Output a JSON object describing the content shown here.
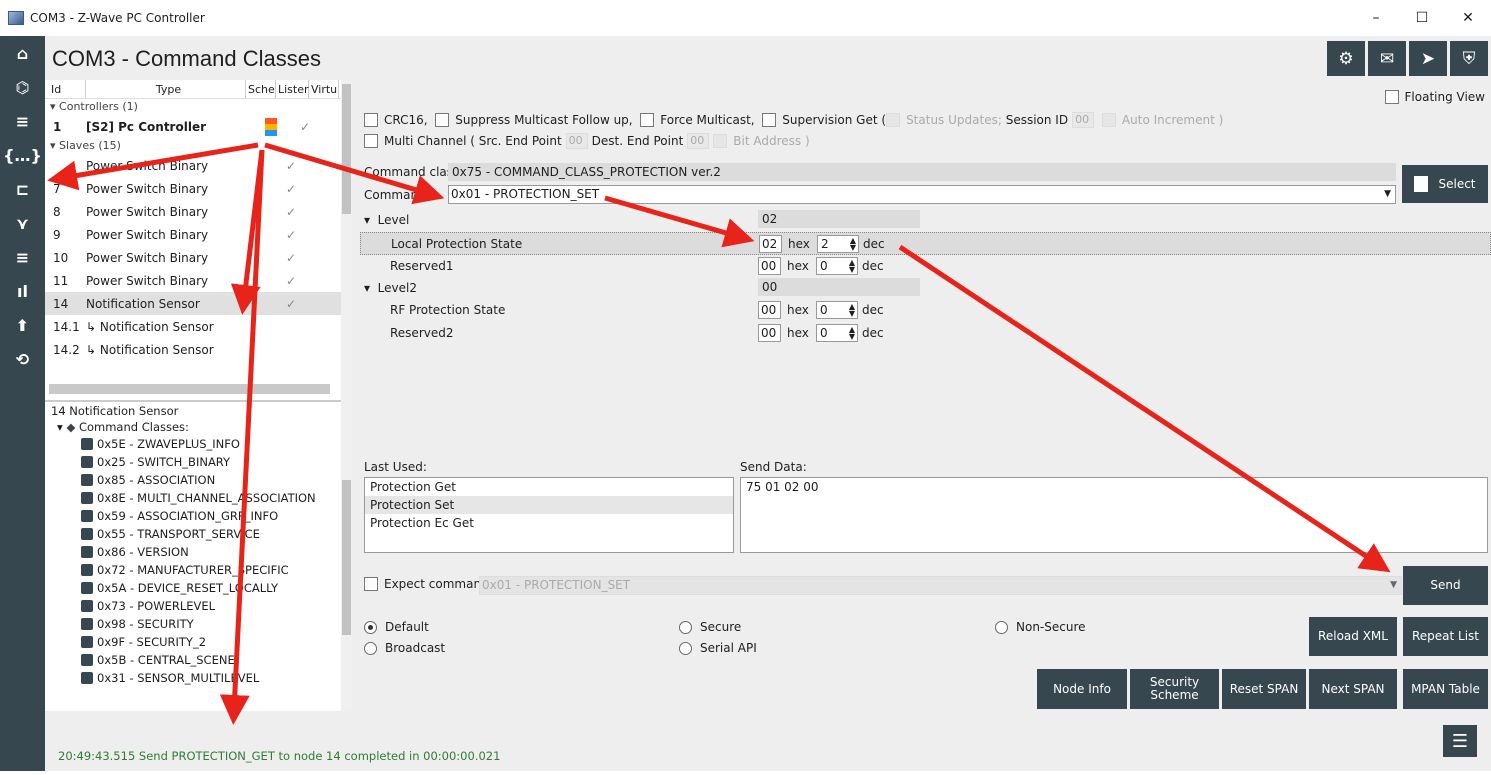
{
  "window": {
    "title": "COM3 - Z-Wave PC Controller",
    "minimize": "–",
    "maximize": "☐",
    "close": "✕"
  },
  "nav": {
    "home": "⌂",
    "router": "⌬",
    "list": "≡",
    "command_classes": "{…}",
    "topology": "⊏",
    "network": "⋎",
    "queue": "≡",
    "chart": "ıl",
    "upload": "⬆",
    "restore": "⟲"
  },
  "header": {
    "title": "COM3 - Command Classes",
    "settings": "⚙",
    "mail": "✉",
    "send": "➤",
    "shield": "⛨"
  },
  "nodes": {
    "columns": [
      "Id",
      "Type",
      "Sche",
      "Lister",
      "Virtu"
    ],
    "controllers_group": "Controllers (1)",
    "controller": {
      "id": "1",
      "type": "[S2] Pc Controller",
      "listening": "✓"
    },
    "slaves_group": "Slaves (15)",
    "slaves": [
      {
        "id": "",
        "type": "Power Switch Binary",
        "listening": "✓"
      },
      {
        "id": "7",
        "type": "Power Switch Binary",
        "listening": "✓"
      },
      {
        "id": "8",
        "type": "Power Switch Binary",
        "listening": "✓"
      },
      {
        "id": "9",
        "type": "Power Switch Binary",
        "listening": "✓"
      },
      {
        "id": "10",
        "type": "Power Switch Binary",
        "listening": "✓"
      },
      {
        "id": "11",
        "type": "Power Switch Binary",
        "listening": "✓"
      },
      {
        "id": "14",
        "type": "Notification Sensor",
        "listening": "✓"
      },
      {
        "id": "14.1",
        "type": "↳ Notification Sensor",
        "listening": ""
      },
      {
        "id": "14.2",
        "type": "↳ Notification Sensor",
        "listening": ""
      }
    ]
  },
  "info": {
    "title": "14 Notification Sensor",
    "cc_header": "Command Classes:",
    "classes": [
      "0x5E - ZWAVEPLUS_INFO",
      "0x25 - SWITCH_BINARY",
      "0x85 - ASSOCIATION",
      "0x8E - MULTI_CHANNEL_ASSOCIATION",
      "0x59 - ASSOCIATION_GRP_INFO",
      "0x55 - TRANSPORT_SERVICE",
      "0x86 - VERSION",
      "0x72 - MANUFACTURER_SPECIFIC",
      "0x5A - DEVICE_RESET_LOCALLY",
      "0x73 - POWERLEVEL",
      "0x98 - SECURITY",
      "0x9F - SECURITY_2",
      "0x5B - CENTRAL_SCENE",
      "0x31 - SENSOR_MULTILEVEL"
    ]
  },
  "options": {
    "floating_view": "Floating View",
    "crc16": "CRC16,",
    "suppress": "Suppress Multicast Follow up,",
    "force": "Force Multicast,",
    "supervision": "Supervision Get (",
    "status_updates": "Status Updates;",
    "session_id": "Session ID",
    "session_val": "00",
    "auto_increment": "Auto Increment )",
    "multi_channel": "Multi Channel ( Src. End Point",
    "src_val": "00",
    "dest": "Dest. End Point",
    "dest_val": "00",
    "bit_address": "Bit Address )"
  },
  "command": {
    "class_label": "Command class",
    "class_value": "0x75 - COMMAND_CLASS_PROTECTION ver.2",
    "cmd_label": "Command",
    "cmd_value": "0x01 - PROTECTION_SET",
    "select": "Select"
  },
  "params": {
    "level": "Level",
    "level_val": "02",
    "local": "Local Protection State",
    "local_hex": "02",
    "local_dec": "2",
    "reserved1": "Reserved1",
    "reserved1_hex": "00",
    "reserved1_dec": "0",
    "level2": "Level2",
    "level2_val": "00",
    "rf": "RF Protection State",
    "rf_hex": "00",
    "rf_dec": "0",
    "reserved2": "Reserved2",
    "reserved2_hex": "00",
    "reserved2_dec": "0",
    "hex": "hex",
    "dec": "dec"
  },
  "history": {
    "last_used_label": "Last Used:",
    "items": [
      "Protection Get",
      "Protection Set",
      "Protection Ec Get"
    ],
    "send_data_label": "Send Data:",
    "send_data": "75 01 02 00"
  },
  "expect": {
    "label": "Expect command",
    "value": "0x01 - PROTECTION_SET",
    "send": "Send"
  },
  "security": {
    "default": "Default",
    "secure": "Secure",
    "non_secure": "Non-Secure",
    "broadcast": "Broadcast",
    "serial_api": "Serial API"
  },
  "buttons": {
    "reload_xml": "Reload XML",
    "repeat_list": "Repeat List",
    "node_info": "Node Info",
    "security_scheme": "Security Scheme",
    "reset_span": "Reset SPAN",
    "next_span": "Next SPAN",
    "mpan_table": "MPAN Table"
  },
  "status": {
    "text": "20:49:43.515 Send PROTECTION_GET to node 14 completed in 00:00:00.021",
    "menu": "☰"
  },
  "colors": {
    "nav": "#37474f",
    "arrow": "#e8231a",
    "status_text": "#2e7d32"
  }
}
